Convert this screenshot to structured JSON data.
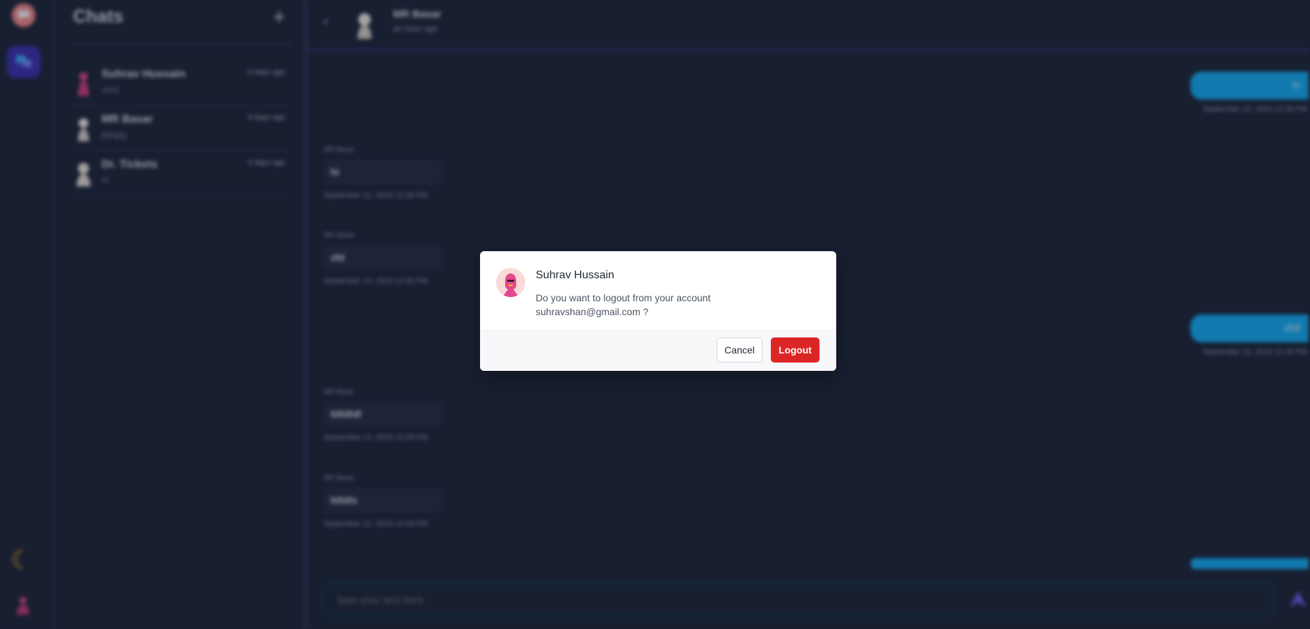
{
  "sidebar_rail": {
    "logo_icon": "chat-bubble-logo-icon",
    "chat_icon": "chat-bubbles-icon",
    "theme_icon": "moon-icon",
    "profile_icon": "user-avatar-icon",
    "accent": "#3b2fb0"
  },
  "chat_list": {
    "title": "Chats",
    "add_icon": "plus-icon",
    "items": [
      {
        "name": "Suhrav Hussain",
        "preview": "uhvil",
        "time": "9 days ago"
      },
      {
        "name": "MR Basar",
        "preview": "jhjhgfg",
        "time": "9 days ago"
      },
      {
        "name": "Dr. Tickets",
        "preview": "sf",
        "time": "9 days ago"
      }
    ]
  },
  "chat": {
    "contact_name": "MR Basar",
    "status": "an hour ago",
    "back_icon": "chevron-left-icon",
    "messages": [
      {
        "direction": "out",
        "text": "hi",
        "time": "September 12, 2023 12:26 PM"
      },
      {
        "direction": "in",
        "sender": "MR Basar",
        "text": "hi",
        "time": "September 12, 2023 12:26 PM"
      },
      {
        "direction": "in",
        "sender": "MR Basar",
        "text": "zfd",
        "time": "September 12, 2023 12:26 PM"
      },
      {
        "direction": "out",
        "text": "dfdf",
        "time": "September 12, 2023 12:26 PM"
      },
      {
        "direction": "in",
        "sender": "MR Basar",
        "text": "fdfdfdf",
        "time": "September 12, 2023 12:26 PM"
      },
      {
        "direction": "in",
        "sender": "MR Basar",
        "text": "fdfdfs",
        "time": "September 12, 2023 12:26 PM"
      }
    ],
    "input_placeholder": "type your text here",
    "send_icon": "send-icon",
    "outgoing_color": "#11aef5"
  },
  "logout_modal": {
    "user_name": "Suhrav Hussain",
    "message": "Do you want to logout from your account suhravshan@gmail.com ?",
    "cancel_label": "Cancel",
    "logout_label": "Logout",
    "logout_color": "#dc2626"
  }
}
